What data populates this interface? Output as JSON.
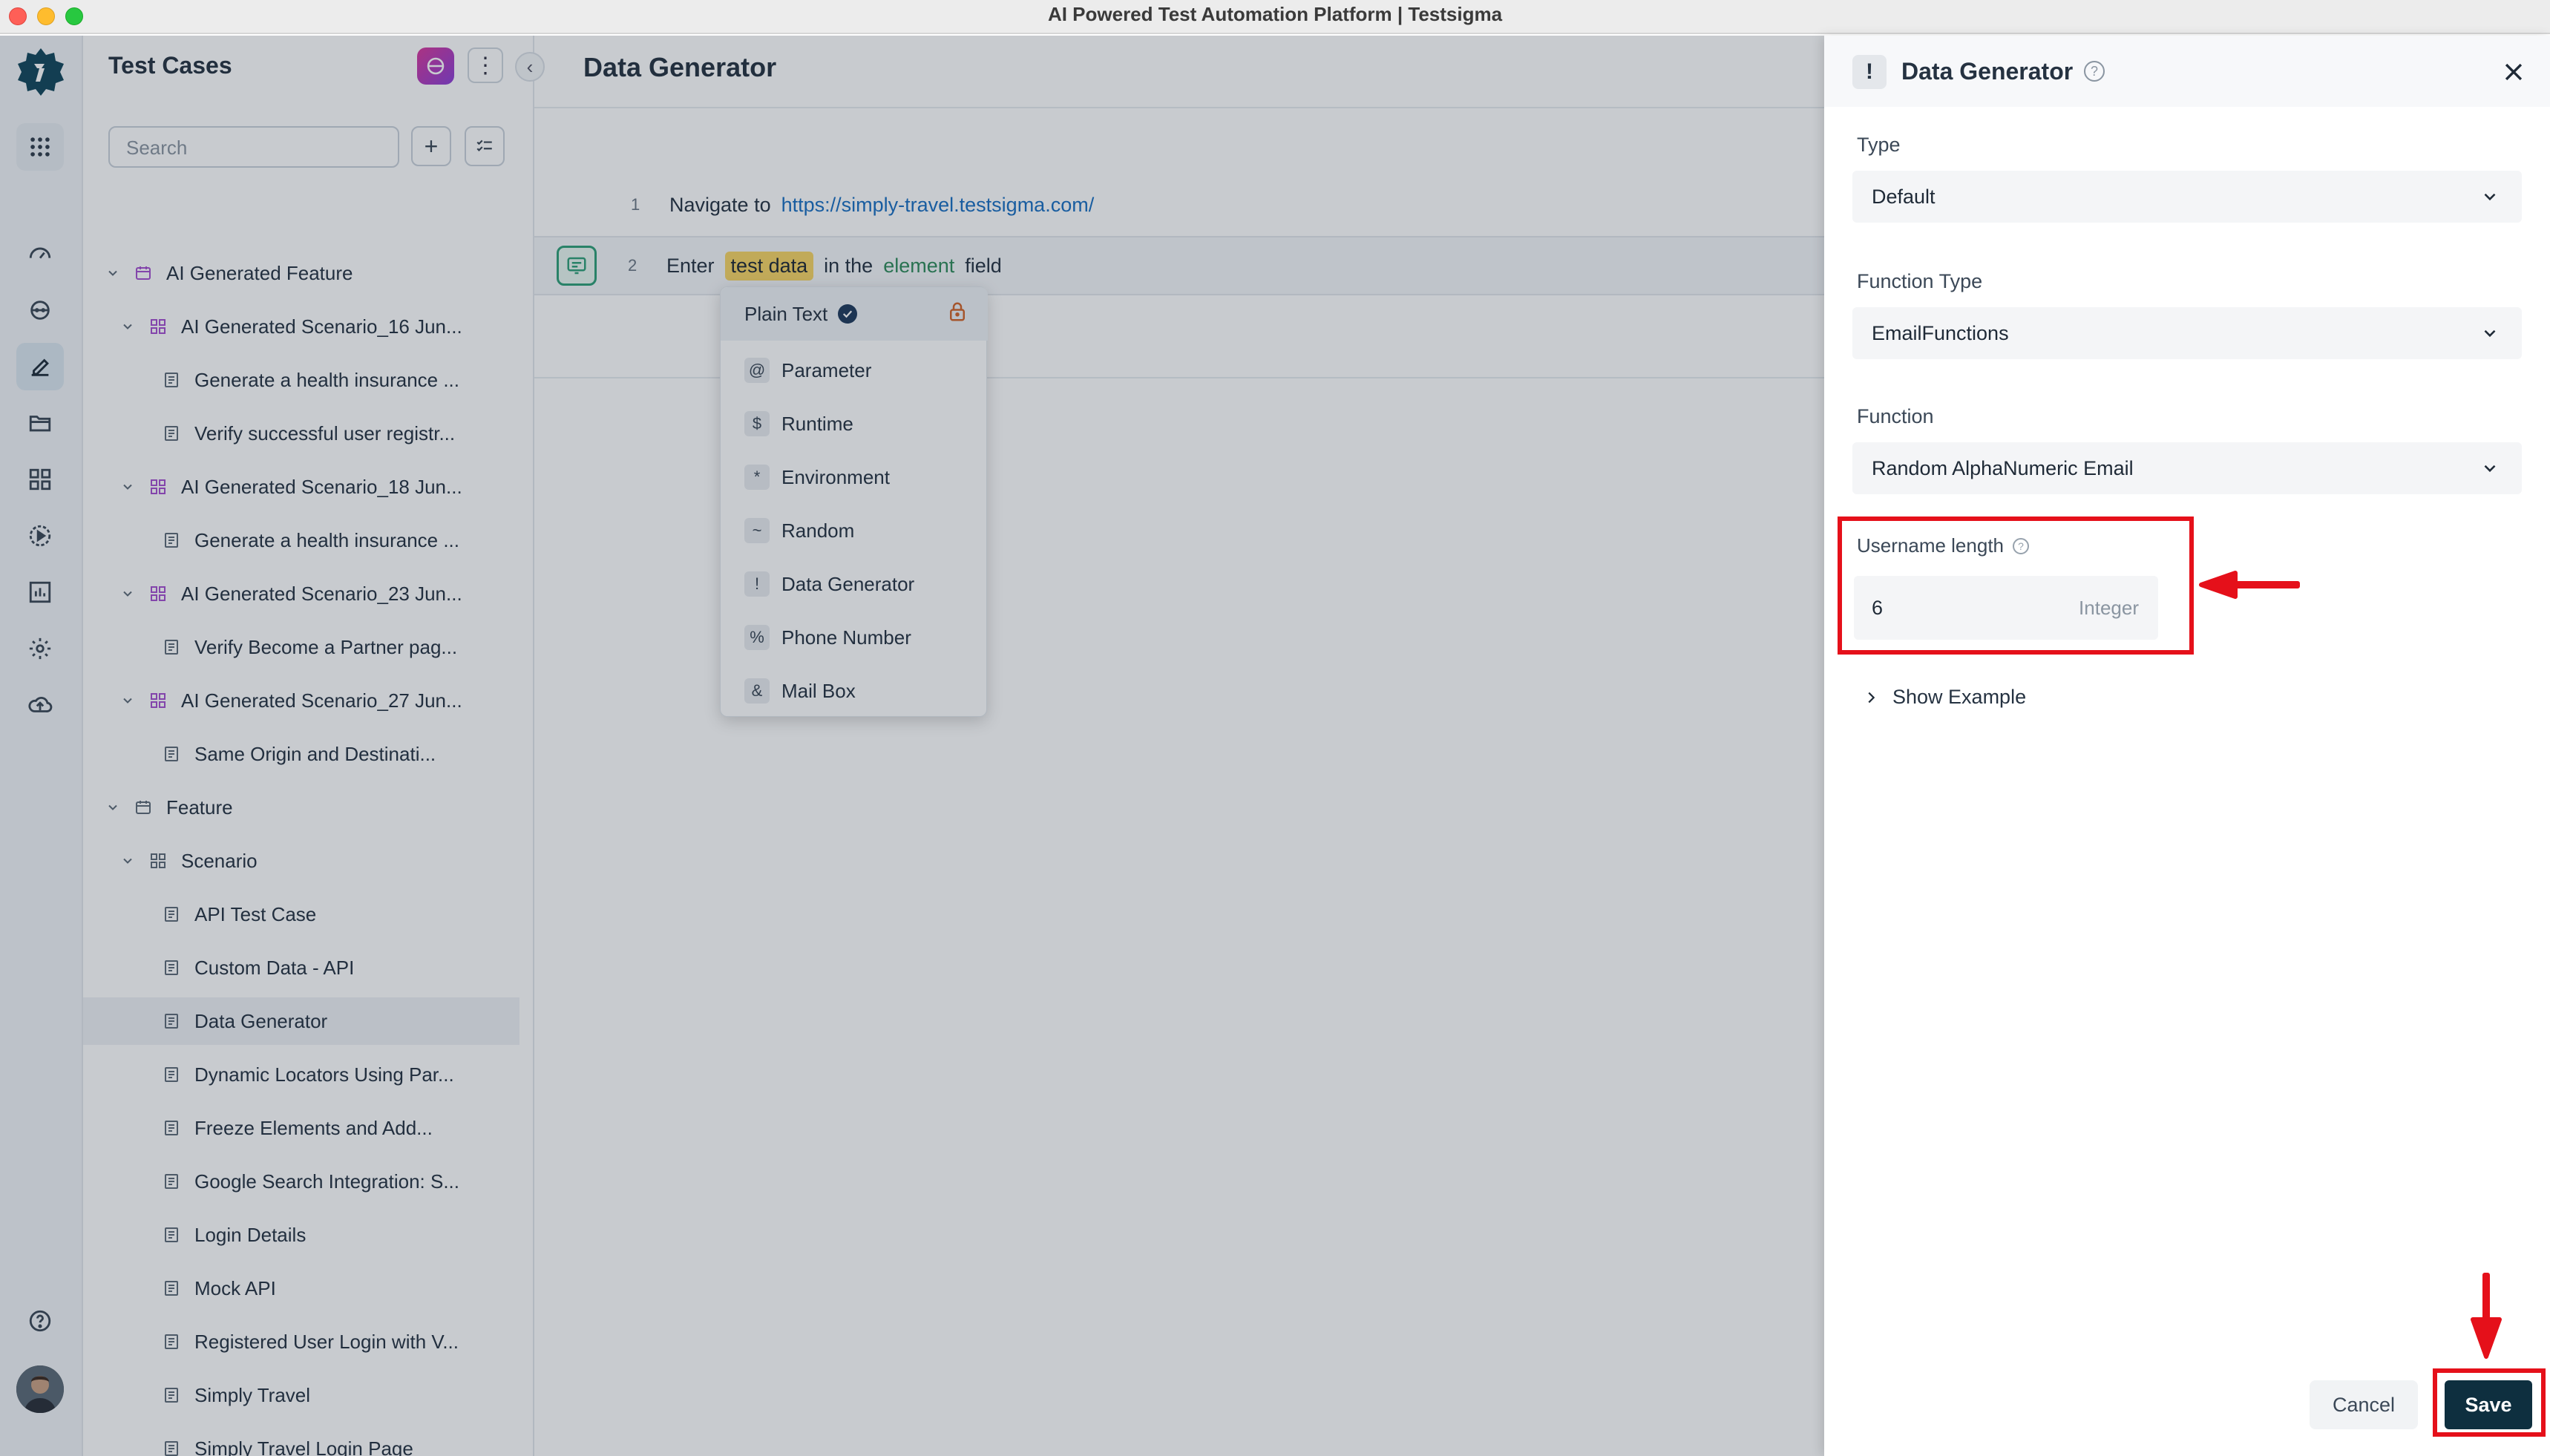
{
  "window": {
    "title": "AI Powered Test Automation Platform | Testsigma"
  },
  "sidebar": {
    "title": "Test Cases",
    "search_placeholder": "Search",
    "tree": [
      {
        "label": "AI Generated Feature",
        "level": 0,
        "kind": "feature"
      },
      {
        "label": "AI Generated Scenario_16 Jun...",
        "level": 1,
        "kind": "scenario"
      },
      {
        "label": "Generate a health insurance ...",
        "level": 2,
        "kind": "case"
      },
      {
        "label": "Verify successful user registr...",
        "level": 2,
        "kind": "case"
      },
      {
        "label": "AI Generated Scenario_18 Jun...",
        "level": 1,
        "kind": "scenario"
      },
      {
        "label": "Generate a health insurance ...",
        "level": 2,
        "kind": "case"
      },
      {
        "label": "AI Generated Scenario_23 Jun...",
        "level": 1,
        "kind": "scenario"
      },
      {
        "label": "Verify Become a Partner pag...",
        "level": 2,
        "kind": "case"
      },
      {
        "label": "AI Generated Scenario_27 Jun...",
        "level": 1,
        "kind": "scenario"
      },
      {
        "label": "Same Origin and Destinati...",
        "level": 2,
        "kind": "case"
      },
      {
        "label": "Feature",
        "level": 0,
        "kind": "feature"
      },
      {
        "label": "Scenario",
        "level": 1,
        "kind": "scenario"
      },
      {
        "label": "API Test Case",
        "level": 2,
        "kind": "case"
      },
      {
        "label": "Custom Data - API",
        "level": 2,
        "kind": "case"
      },
      {
        "label": "Data Generator",
        "level": 2,
        "kind": "case",
        "selected": true
      },
      {
        "label": "Dynamic Locators Using Par...",
        "level": 2,
        "kind": "case"
      },
      {
        "label": "Freeze Elements and Add...",
        "level": 2,
        "kind": "case"
      },
      {
        "label": "Google Search Integration: S...",
        "level": 2,
        "kind": "case"
      },
      {
        "label": "Login Details",
        "level": 2,
        "kind": "case"
      },
      {
        "label": "Mock API",
        "level": 2,
        "kind": "case"
      },
      {
        "label": "Registered User Login with V...",
        "level": 2,
        "kind": "case"
      },
      {
        "label": "Simply Travel",
        "level": 2,
        "kind": "case"
      },
      {
        "label": "Simply Travel Login Page",
        "level": 2,
        "kind": "case"
      }
    ]
  },
  "editor": {
    "title": "Data Generator",
    "steps": [
      {
        "num": "1",
        "action": "Navigate to",
        "url": "https://simply-travel.testsigma.com/"
      },
      {
        "num": "2",
        "action": "Enter",
        "chip": "test data",
        "middle": "in the",
        "element": "element",
        "tail": "field"
      }
    ],
    "dropdown": [
      {
        "symbol": "",
        "label": "Plain Text"
      },
      {
        "symbol": "@",
        "label": "Parameter"
      },
      {
        "symbol": "$",
        "label": "Runtime"
      },
      {
        "symbol": "*",
        "label": "Environment"
      },
      {
        "symbol": "~",
        "label": "Random"
      },
      {
        "symbol": "!",
        "label": "Data Generator"
      },
      {
        "symbol": "%",
        "label": "Phone Number"
      },
      {
        "symbol": "&",
        "label": "Mail Box"
      }
    ]
  },
  "panel": {
    "icon_symbol": "!",
    "title": "Data Generator",
    "type_label": "Type",
    "type_value": "Default",
    "function_type_label": "Function Type",
    "function_type_value": "EmailFunctions",
    "function_label": "Function",
    "function_value": "Random AlphaNumeric Email",
    "username_label": "Username length",
    "username_value": "6",
    "username_type": "Integer",
    "show_example": "Show Example",
    "cancel_label": "Cancel",
    "save_label": "Save"
  },
  "colors": {
    "highlight": "#e5101a",
    "save_button": "#0e2f3f",
    "chip": "#f6d465",
    "link": "#1a6fc2"
  }
}
